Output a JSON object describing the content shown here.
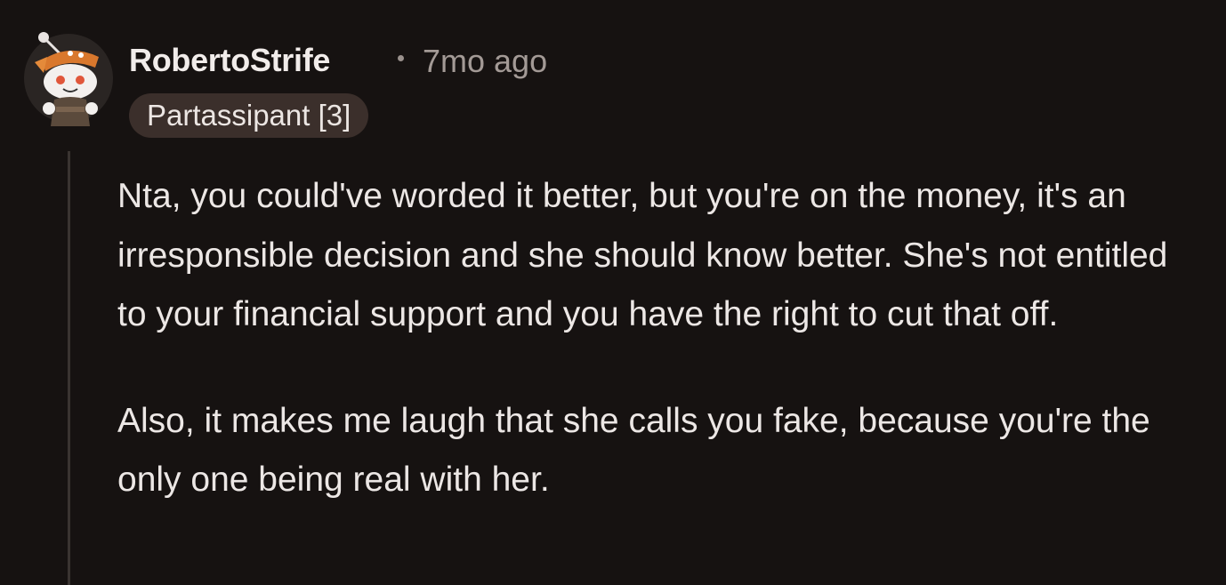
{
  "comment": {
    "author": "RobertoStrife",
    "separator": "•",
    "timestamp": "7mo ago",
    "flair": "Partassipant [3]",
    "paragraphs": [
      "Nta, you could've worded it better, but you're on the money, it's an irresponsible decision and she should know better. She's not entitled to your financial support and you have the right to cut that off.",
      "Also, it makes me laugh that she calls you fake, because you're the only one being real with her."
    ]
  },
  "icons": {
    "avatar": "snoo-pirate-avatar"
  },
  "colors": {
    "background": "#161211",
    "flair_background": "#3b2f2b",
    "text": "#ece7e5",
    "muted": "#a39a96",
    "thread_line": "#3a3431"
  }
}
